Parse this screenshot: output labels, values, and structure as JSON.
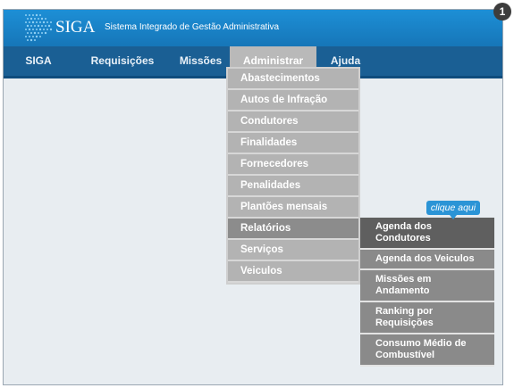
{
  "app": {
    "logo_text": "SIGA",
    "system_name": "Sistema Integrado de Gestão Administrativa"
  },
  "nav": {
    "items": [
      {
        "label": "SIGA"
      },
      {
        "label": "Requisições"
      },
      {
        "label": "Missões"
      },
      {
        "label": "Administrar",
        "active": true
      },
      {
        "label": "Ajuda"
      }
    ]
  },
  "menu": {
    "items": [
      {
        "label": "Abastecimentos"
      },
      {
        "label": "Autos de Infração"
      },
      {
        "label": "Condutores"
      },
      {
        "label": "Finalidades"
      },
      {
        "label": "Fornecedores"
      },
      {
        "label": "Penalidades"
      },
      {
        "label": "Plantões mensais"
      },
      {
        "label": "Relatórios",
        "active": true
      },
      {
        "label": "Serviços"
      },
      {
        "label": "Veiculos"
      }
    ]
  },
  "submenu": {
    "items": [
      {
        "label": "Agenda dos Condutores",
        "active": true
      },
      {
        "label": "Agenda dos Veiculos"
      },
      {
        "label": "Missões em Andamento"
      },
      {
        "label": "Ranking por Requisições"
      },
      {
        "label": "Consumo Médio de Combustível"
      }
    ]
  },
  "tooltip": {
    "text": "clique aqui"
  },
  "step_badge": {
    "text": "1"
  },
  "colors": {
    "header_blue": "#1a82c8",
    "nav_blue": "#1a5f94",
    "menu_gray": "#b3b3b3",
    "active_gray": "#8c8c8c",
    "submenu_gray": "#8a8a8a",
    "submenu_active": "#5f5f5f",
    "tooltip_blue": "#2b94d6"
  }
}
